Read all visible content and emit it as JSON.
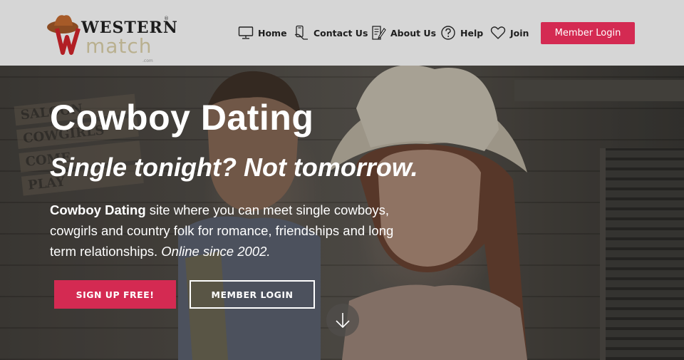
{
  "logo": {
    "word1": "WESTERN",
    "word2": "match",
    "domain": ".com",
    "registered": "®"
  },
  "nav": {
    "items": [
      {
        "label": "Home",
        "icon": "monitor-icon"
      },
      {
        "label": "Contact Us",
        "icon": "phone-hand-icon"
      },
      {
        "label": "About Us",
        "icon": "document-pen-icon"
      },
      {
        "label": "Help",
        "icon": "question-circle-icon"
      },
      {
        "label": "Join",
        "icon": "heart-icon"
      }
    ],
    "member_login": "Member Login"
  },
  "hero": {
    "title": "Cowboy Dating",
    "subtitle": "Single tonight? Not tomorrow.",
    "desc_bold": "Cowboy Dating",
    "desc_text": " site where you can meet single cowboys, cowgirls and country folk for romance, friendships and long term relationships. ",
    "desc_italic": "Online since 2002.",
    "signup_label": "SIGN UP FREE!",
    "login_label": "MEMBER LOGIN",
    "sign_words": [
      "SALOON",
      "COWGIRLS",
      "COME",
      "PLAY"
    ]
  },
  "colors": {
    "accent": "#d42a52",
    "header_bg": "#d6d6d6",
    "text_dark": "#1e1e1e",
    "logo_match": "#b9b08f"
  }
}
